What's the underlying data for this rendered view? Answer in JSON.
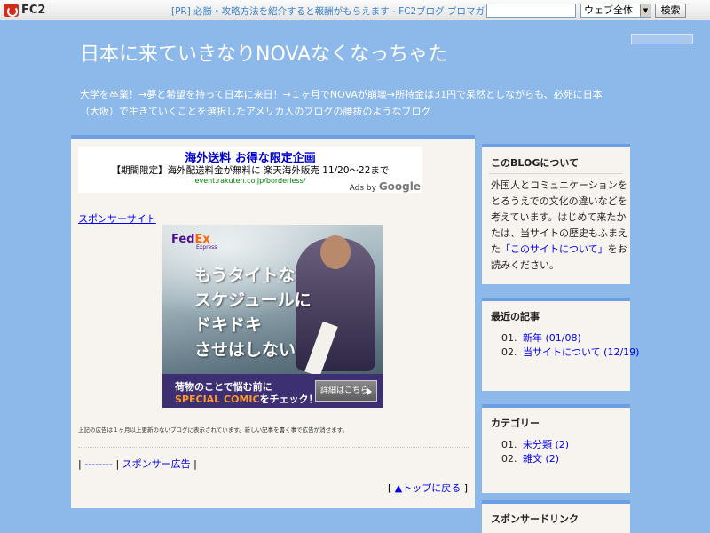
{
  "topbar": {
    "logo": "FC2",
    "pr_text": "[PR] 必勝・攻略方法を紹介すると報酬がもらえます - FC2ブログ ブロマガ",
    "search_placeholder": "",
    "scope": "ウェブ全体",
    "search_button": "検索"
  },
  "header": {
    "title": "日本に来ていきなりNOVAなくなっちゃた",
    "description": "大学を卒業！→夢と希望を持って日本に来日！→１ヶ月でNOVAが崩壊→所持金は31円で呆然としながらも、必死に日本（大阪）で生きていくことを選択したアメリカ人のブログの腰抜のようなブログ"
  },
  "main": {
    "ad": {
      "headline": "海外送料 お得な限定企画",
      "body": "【期間限定】海外配送料金が無料に 楽天海外販売 11/20～22まで",
      "url": "event.rakuten.co.jp/borderless/",
      "ads_by": "Ads by",
      "google": "Google"
    },
    "sponsor_site": "スポンサーサイト",
    "banner": {
      "logo_fed": "Fed",
      "logo_ex": "Ex",
      "logo_sub": "Express",
      "lines": [
        "もうタイトな",
        "スケジュールに",
        "ドキドキ",
        "させはしない"
      ],
      "cta_line1": "荷物のことで悩む前に",
      "cta_highlight": "SPECIAL COMIC",
      "cta_line2_rest": "をチェック！",
      "detail_button": "詳細はこちら"
    },
    "notice": "上記の広告は１ヶ月以上更新のないブログに表示されています。新しい記事を書く事で広告が消せます。",
    "nav": {
      "sep_open": "| ",
      "link1": "--------",
      "sep_mid": " | ",
      "link2": "スポンサー広告",
      "sep_close": " |"
    },
    "to_top": {
      "open": "[ ",
      "label": "▲トップに戻る",
      "close": " ]"
    }
  },
  "sidebar": {
    "about": {
      "title": "このBLOGについて",
      "text_before": "外国人とコミュニケーションをとるうえでの文化の違いなどを考えています。はじめて来たかたは、当サイトの歴史もふまえた",
      "link": "「このサイトについて」",
      "text_after": "をお読みください。"
    },
    "recent": {
      "title": "最近の記事",
      "items": [
        {
          "num": "01.",
          "label": "新年 (01/08)"
        },
        {
          "num": "02.",
          "label": "当サイトについて (12/19)"
        }
      ]
    },
    "categories": {
      "title": "カテゴリー",
      "items": [
        {
          "num": "01.",
          "label": "未分類 (2)"
        },
        {
          "num": "02.",
          "label": "雑文 (2)"
        }
      ]
    },
    "sponsor_links": {
      "title": "スポンサードリンク"
    }
  },
  "colors": {
    "background": "#8db8ea",
    "panel": "#f7f4f0",
    "accent": "#6b9fe2",
    "link": "#0000ee"
  }
}
